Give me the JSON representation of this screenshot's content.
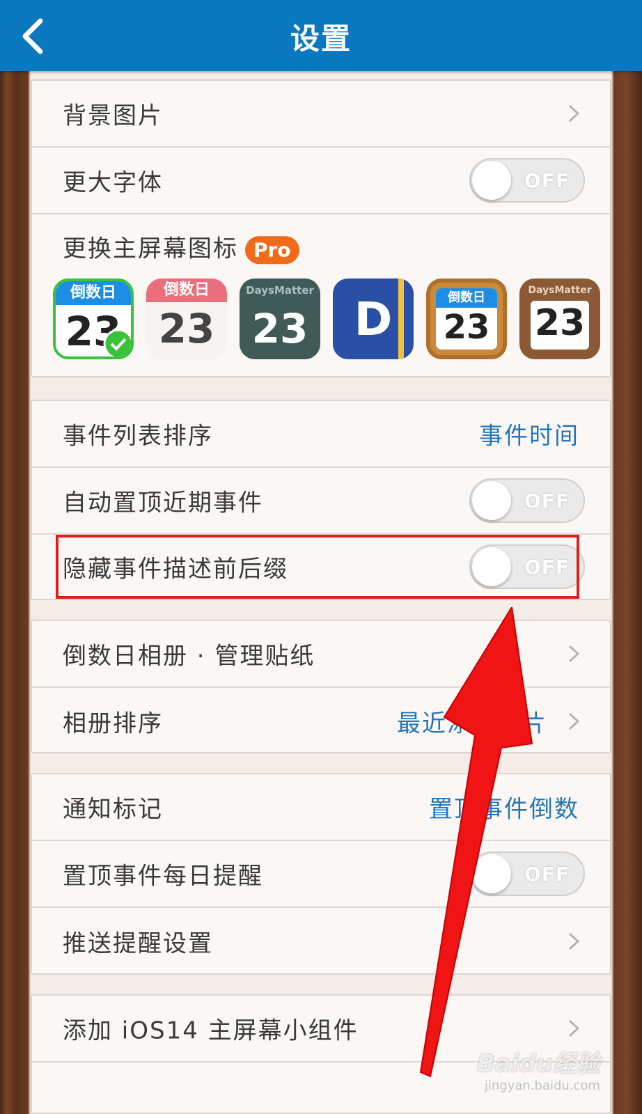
{
  "nav": {
    "title": "设置"
  },
  "group1": {
    "background_image": {
      "label": "背景图片"
    },
    "larger_font": {
      "label": "更大字体",
      "toggle": "OFF"
    },
    "change_icon": {
      "label": "更换主屏幕图标",
      "badge": "Pro"
    },
    "icons": [
      {
        "header": "倒数日",
        "number": "23",
        "selected": true
      },
      {
        "header": "倒数日",
        "number": "23"
      },
      {
        "header": "DaysMatter",
        "number": "23"
      },
      {
        "header": "",
        "number": "D"
      },
      {
        "header": "倒数日",
        "number": "23"
      },
      {
        "header": "DaysMatter",
        "number": "23"
      }
    ]
  },
  "group2": {
    "sort": {
      "label": "事件列表排序",
      "value": "事件时间"
    },
    "auto_pin": {
      "label": "自动置顶近期事件",
      "toggle": "OFF"
    },
    "hide_affix": {
      "label": "隐藏事件描述前后缀",
      "toggle": "OFF"
    }
  },
  "group3": {
    "album": {
      "label": "倒数日相册 · 管理贴纸"
    },
    "album_sort": {
      "label": "相册排序",
      "value": "最近添加照片"
    }
  },
  "group4": {
    "notify_badge": {
      "label": "通知标记",
      "value": "置顶事件倒数"
    },
    "daily_reminder": {
      "label": "置顶事件每日提醒",
      "toggle": "OFF"
    },
    "push_settings": {
      "label": "推送提醒设置"
    }
  },
  "group5": {
    "widget": {
      "label": "添加 iOS14 主屏幕小组件"
    }
  },
  "watermark": {
    "main": "Baidu经验",
    "sub": "jingyan.baidu.com"
  },
  "colors": {
    "nav": "#0a78bf",
    "link": "#2576b8",
    "highlight": "#e21d1d",
    "pro": "#f06a1c"
  }
}
